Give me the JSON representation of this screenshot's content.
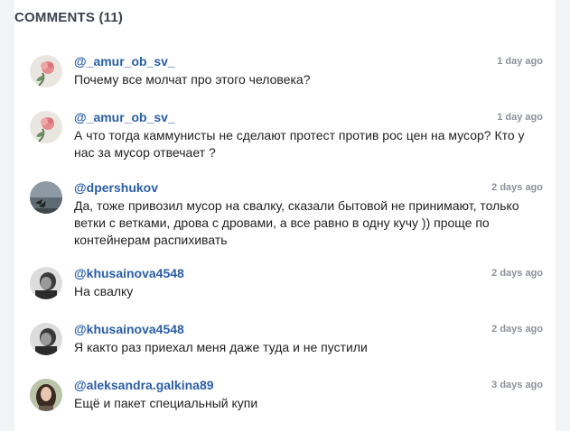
{
  "header": {
    "title": "COMMENTS (11)"
  },
  "comments": [
    {
      "author": "@_amur_ob_sv_",
      "time": "1 day ago",
      "text": "Почему все молчат про этого человека?",
      "avatar": "flower-avatar"
    },
    {
      "author": "@_amur_ob_sv_",
      "time": "1 day ago",
      "text": "А что тогда каммунисты не сделают протест против рос цен на мусор? Кто у нас за мусор отвечает ?",
      "avatar": "flower-avatar"
    },
    {
      "author": "@dpershukov",
      "time": "2 days ago",
      "text": "Да, тоже привозил мусор на свалку, сказали бытовой не принимают, только ветки с ветками, дрова с дровами, а все равно в одну кучу )) проще по контейнерам распихивать",
      "avatar": "bird-sky-avatar"
    },
    {
      "author": "@khusainova4548",
      "time": "2 days ago",
      "text": "На свалку",
      "avatar": "bw-portrait-avatar"
    },
    {
      "author": "@khusainova4548",
      "time": "2 days ago",
      "text": "Я както раз приехал меня даже туда и не пустили",
      "avatar": "bw-portrait-avatar"
    },
    {
      "author": "@aleksandra.galkina89",
      "time": "3 days ago",
      "text": "Ещё и пакет специальный купи",
      "avatar": "woman-portrait-avatar"
    }
  ]
}
